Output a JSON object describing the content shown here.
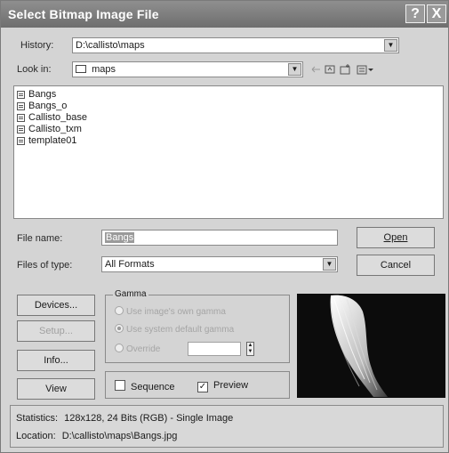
{
  "window": {
    "title": "Select Bitmap Image File",
    "help_label": "?",
    "close_label": "X"
  },
  "history": {
    "label": "History:",
    "value": "D:\\callisto\\maps"
  },
  "look_in": {
    "label": "Look in:",
    "value": "maps",
    "back_icon": "back-arrow-icon",
    "up_icon": "up-folder-icon",
    "new_icon": "new-folder-icon",
    "view_icon": "view-menu-icon"
  },
  "files": [
    {
      "name": "Bangs"
    },
    {
      "name": "Bangs_o"
    },
    {
      "name": "Callisto_base"
    },
    {
      "name": "Callisto_txm"
    },
    {
      "name": "template01"
    }
  ],
  "file_name": {
    "label": "File name:",
    "value": "Bangs"
  },
  "files_of_type": {
    "label": "Files of type:",
    "value": "All Formats"
  },
  "buttons": {
    "open": "Open",
    "cancel": "Cancel",
    "devices": "Devices...",
    "setup": "Setup...",
    "info": "Info...",
    "view": "View"
  },
  "gamma": {
    "legend": "Gamma",
    "own": "Use image's own gamma",
    "system": "Use system default gamma",
    "override": "Override",
    "override_value": ""
  },
  "sequence_label": "Sequence",
  "preview_label": "Preview",
  "preview_checked": true,
  "sequence_checked": false,
  "statistics": {
    "label": "Statistics:",
    "value": "128x128, 24 Bits (RGB) - Single Image"
  },
  "location": {
    "label": "Location:",
    "value": "D:\\callisto\\maps\\Bangs.jpg"
  }
}
